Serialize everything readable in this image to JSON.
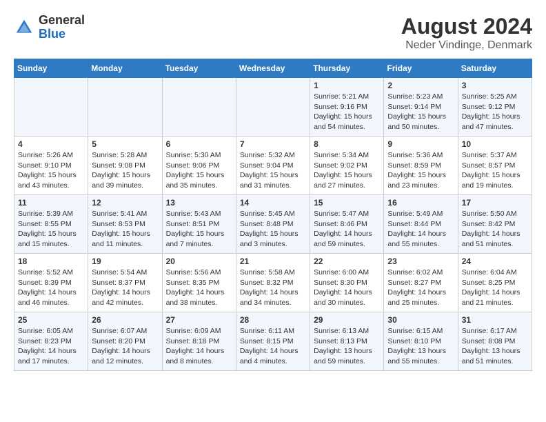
{
  "logo": {
    "line1": "General",
    "line2": "Blue"
  },
  "title": "August 2024",
  "subtitle": "Neder Vindinge, Denmark",
  "weekdays": [
    "Sunday",
    "Monday",
    "Tuesday",
    "Wednesday",
    "Thursday",
    "Friday",
    "Saturday"
  ],
  "weeks": [
    [
      {
        "day": "",
        "content": ""
      },
      {
        "day": "",
        "content": ""
      },
      {
        "day": "",
        "content": ""
      },
      {
        "day": "",
        "content": ""
      },
      {
        "day": "1",
        "content": "Sunrise: 5:21 AM\nSunset: 9:16 PM\nDaylight: 15 hours\nand 54 minutes."
      },
      {
        "day": "2",
        "content": "Sunrise: 5:23 AM\nSunset: 9:14 PM\nDaylight: 15 hours\nand 50 minutes."
      },
      {
        "day": "3",
        "content": "Sunrise: 5:25 AM\nSunset: 9:12 PM\nDaylight: 15 hours\nand 47 minutes."
      }
    ],
    [
      {
        "day": "4",
        "content": "Sunrise: 5:26 AM\nSunset: 9:10 PM\nDaylight: 15 hours\nand 43 minutes."
      },
      {
        "day": "5",
        "content": "Sunrise: 5:28 AM\nSunset: 9:08 PM\nDaylight: 15 hours\nand 39 minutes."
      },
      {
        "day": "6",
        "content": "Sunrise: 5:30 AM\nSunset: 9:06 PM\nDaylight: 15 hours\nand 35 minutes."
      },
      {
        "day": "7",
        "content": "Sunrise: 5:32 AM\nSunset: 9:04 PM\nDaylight: 15 hours\nand 31 minutes."
      },
      {
        "day": "8",
        "content": "Sunrise: 5:34 AM\nSunset: 9:02 PM\nDaylight: 15 hours\nand 27 minutes."
      },
      {
        "day": "9",
        "content": "Sunrise: 5:36 AM\nSunset: 8:59 PM\nDaylight: 15 hours\nand 23 minutes."
      },
      {
        "day": "10",
        "content": "Sunrise: 5:37 AM\nSunset: 8:57 PM\nDaylight: 15 hours\nand 19 minutes."
      }
    ],
    [
      {
        "day": "11",
        "content": "Sunrise: 5:39 AM\nSunset: 8:55 PM\nDaylight: 15 hours\nand 15 minutes."
      },
      {
        "day": "12",
        "content": "Sunrise: 5:41 AM\nSunset: 8:53 PM\nDaylight: 15 hours\nand 11 minutes."
      },
      {
        "day": "13",
        "content": "Sunrise: 5:43 AM\nSunset: 8:51 PM\nDaylight: 15 hours\nand 7 minutes."
      },
      {
        "day": "14",
        "content": "Sunrise: 5:45 AM\nSunset: 8:48 PM\nDaylight: 15 hours\nand 3 minutes."
      },
      {
        "day": "15",
        "content": "Sunrise: 5:47 AM\nSunset: 8:46 PM\nDaylight: 14 hours\nand 59 minutes."
      },
      {
        "day": "16",
        "content": "Sunrise: 5:49 AM\nSunset: 8:44 PM\nDaylight: 14 hours\nand 55 minutes."
      },
      {
        "day": "17",
        "content": "Sunrise: 5:50 AM\nSunset: 8:42 PM\nDaylight: 14 hours\nand 51 minutes."
      }
    ],
    [
      {
        "day": "18",
        "content": "Sunrise: 5:52 AM\nSunset: 8:39 PM\nDaylight: 14 hours\nand 46 minutes."
      },
      {
        "day": "19",
        "content": "Sunrise: 5:54 AM\nSunset: 8:37 PM\nDaylight: 14 hours\nand 42 minutes."
      },
      {
        "day": "20",
        "content": "Sunrise: 5:56 AM\nSunset: 8:35 PM\nDaylight: 14 hours\nand 38 minutes."
      },
      {
        "day": "21",
        "content": "Sunrise: 5:58 AM\nSunset: 8:32 PM\nDaylight: 14 hours\nand 34 minutes."
      },
      {
        "day": "22",
        "content": "Sunrise: 6:00 AM\nSunset: 8:30 PM\nDaylight: 14 hours\nand 30 minutes."
      },
      {
        "day": "23",
        "content": "Sunrise: 6:02 AM\nSunset: 8:27 PM\nDaylight: 14 hours\nand 25 minutes."
      },
      {
        "day": "24",
        "content": "Sunrise: 6:04 AM\nSunset: 8:25 PM\nDaylight: 14 hours\nand 21 minutes."
      }
    ],
    [
      {
        "day": "25",
        "content": "Sunrise: 6:05 AM\nSunset: 8:23 PM\nDaylight: 14 hours\nand 17 minutes."
      },
      {
        "day": "26",
        "content": "Sunrise: 6:07 AM\nSunset: 8:20 PM\nDaylight: 14 hours\nand 12 minutes."
      },
      {
        "day": "27",
        "content": "Sunrise: 6:09 AM\nSunset: 8:18 PM\nDaylight: 14 hours\nand 8 minutes."
      },
      {
        "day": "28",
        "content": "Sunrise: 6:11 AM\nSunset: 8:15 PM\nDaylight: 14 hours\nand 4 minutes."
      },
      {
        "day": "29",
        "content": "Sunrise: 6:13 AM\nSunset: 8:13 PM\nDaylight: 13 hours\nand 59 minutes."
      },
      {
        "day": "30",
        "content": "Sunrise: 6:15 AM\nSunset: 8:10 PM\nDaylight: 13 hours\nand 55 minutes."
      },
      {
        "day": "31",
        "content": "Sunrise: 6:17 AM\nSunset: 8:08 PM\nDaylight: 13 hours\nand 51 minutes."
      }
    ]
  ]
}
